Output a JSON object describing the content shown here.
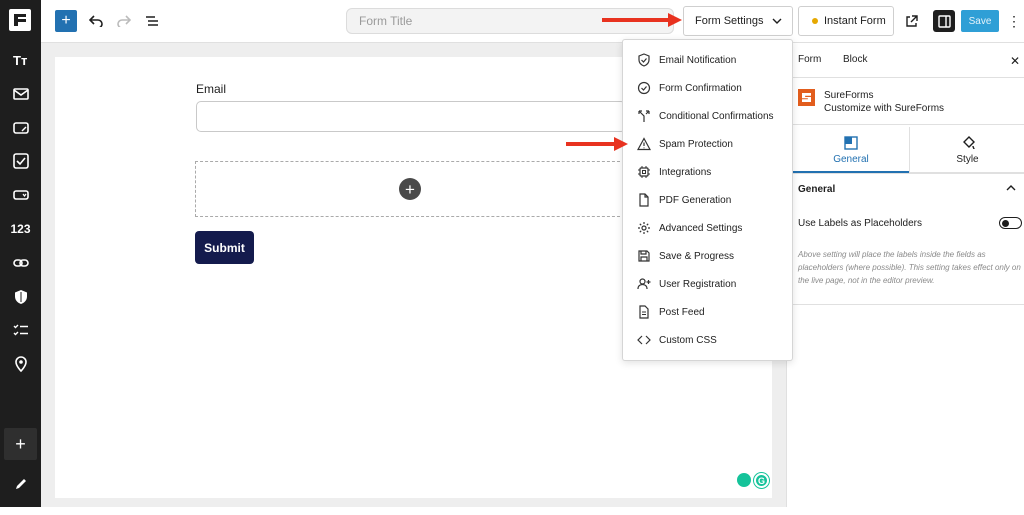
{
  "topbar": {
    "form_title_placeholder": "Form Title",
    "form_settings_label": "Form Settings",
    "instant_form_label": "Instant Form",
    "save_label": "Save"
  },
  "leftbar": {
    "tools": [
      "text-icon",
      "envelope-icon",
      "input-icon",
      "checkbox-icon",
      "dropdown-icon",
      "number-icon",
      "link-icon",
      "shield-icon",
      "checklist-icon",
      "location-icon"
    ],
    "number_tool_label": "123"
  },
  "canvas": {
    "email_label": "Email",
    "submit_label": "Submit"
  },
  "menu": {
    "items": [
      {
        "label": "Email Notification",
        "icon": "shield-check-icon"
      },
      {
        "label": "Form Confirmation",
        "icon": "check-circle-icon"
      },
      {
        "label": "Conditional Confirmations",
        "icon": "branch-icon"
      },
      {
        "label": "Spam Protection",
        "icon": "warning-icon"
      },
      {
        "label": "Integrations",
        "icon": "chip-icon"
      },
      {
        "label": "PDF Generation",
        "icon": "document-icon"
      },
      {
        "label": "Advanced Settings",
        "icon": "gear-icon"
      },
      {
        "label": "Save & Progress",
        "icon": "floppy-icon"
      },
      {
        "label": "User Registration",
        "icon": "user-plus-icon"
      },
      {
        "label": "Post Feed",
        "icon": "page-icon"
      },
      {
        "label": "Custom CSS",
        "icon": "code-icon"
      }
    ]
  },
  "rpanel": {
    "tab_form": "Form",
    "tab_block": "Block",
    "close": "✕",
    "sureforms_name": "SureForms",
    "sureforms_sub": "Customize with SureForms",
    "tab_general": "General",
    "tab_style": "Style",
    "section_general": "General",
    "toggle_label": "Use Labels as Placeholders",
    "help_text": "Above setting will place the labels inside the fields as placeholders (where possible). This setting takes effect only on the live page, not in the editor preview."
  },
  "colors": {
    "accent": "#2271b1",
    "submit_bg": "#141b4d",
    "arrow": "#e8321f",
    "instant_dot": "#e6a800",
    "brand": "#e25d1d"
  }
}
